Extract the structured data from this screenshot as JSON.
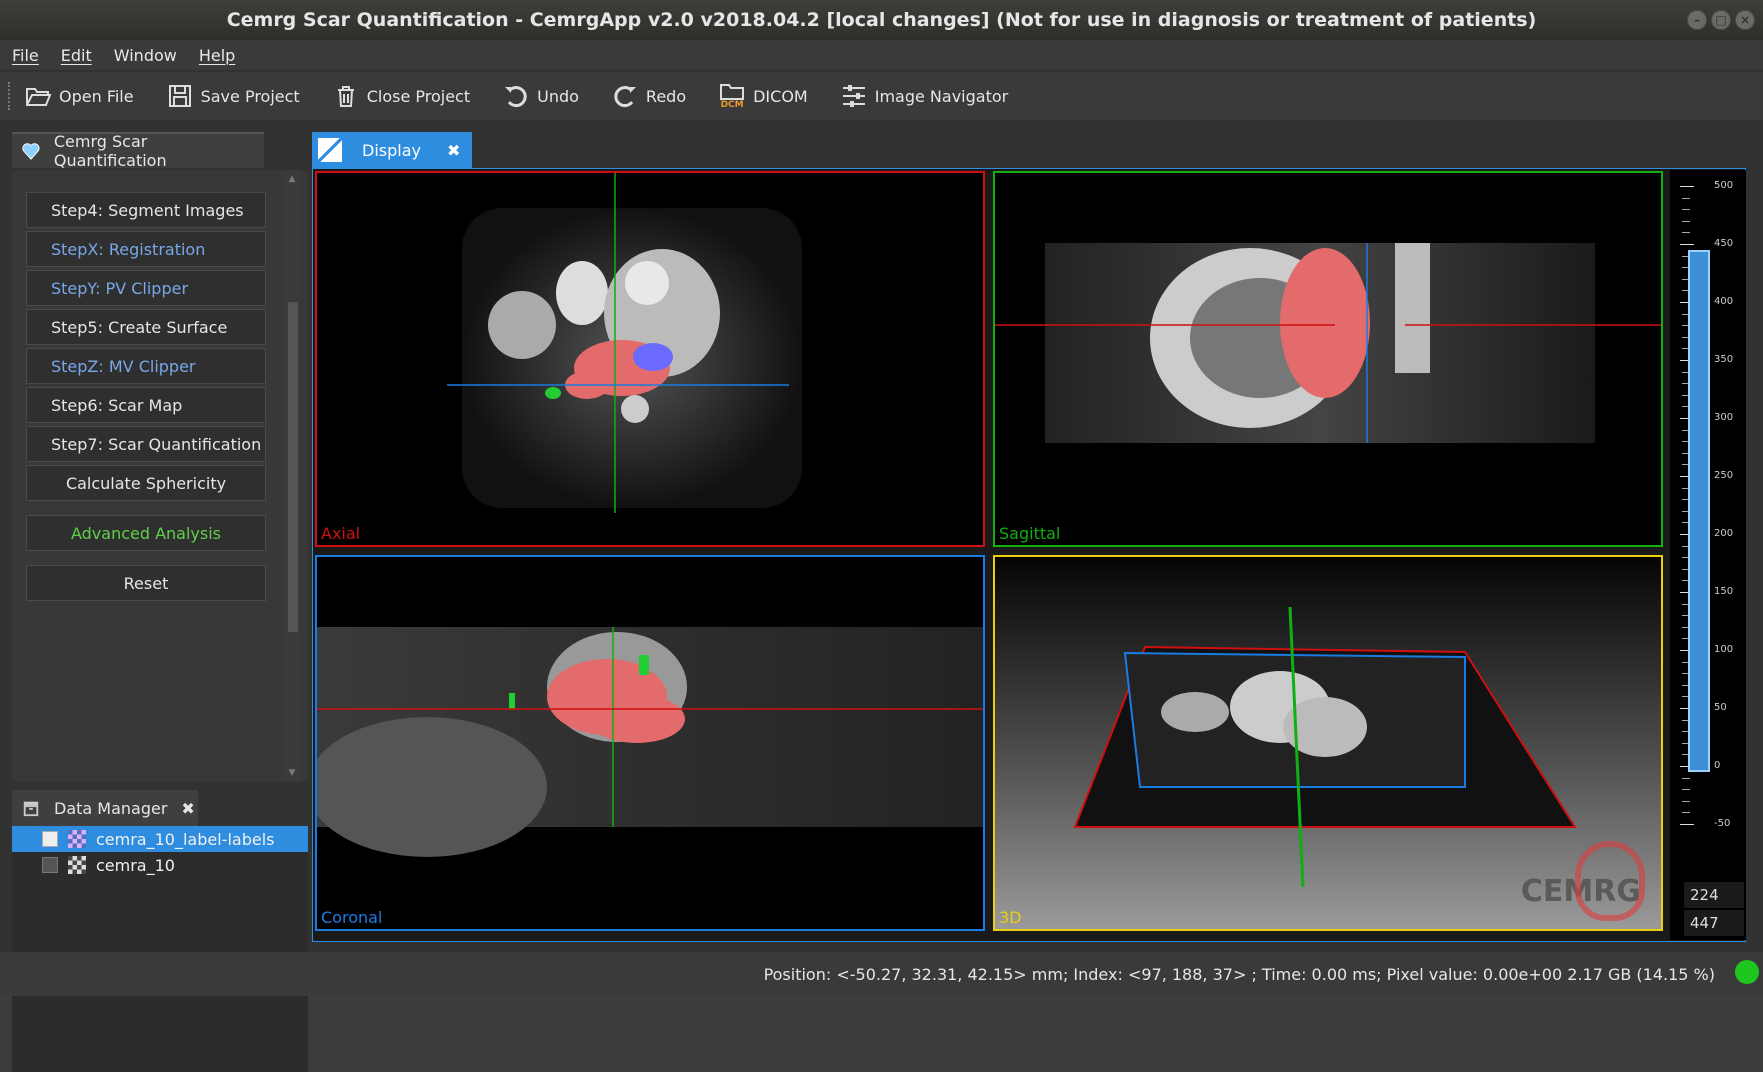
{
  "window": {
    "title": "Cemrg Scar Quantification - CemrgApp v2.0 v2018.04.2 [local changes] (Not for use in diagnosis or treatment of patients)"
  },
  "menu": {
    "file": "File",
    "edit": "Edit",
    "window": "Window",
    "help": "Help"
  },
  "toolbar": {
    "open_file": "Open File",
    "save_project": "Save Project",
    "close_project": "Close Project",
    "undo": "Undo",
    "redo": "Redo",
    "dicom": "DICOM",
    "dicom_icon_text": "DCM",
    "image_navigator": "Image Navigator"
  },
  "plugin": {
    "tab_label": "Cemrg Scar Quantification",
    "steps": [
      {
        "label": "Step4: Segment Images",
        "color": "#e6e6e6"
      },
      {
        "label": "StepX: Registration",
        "color": "#7aa7e8"
      },
      {
        "label": "StepY: PV Clipper",
        "color": "#7aa7e8"
      },
      {
        "label": "Step5: Create Surface",
        "color": "#e6e6e6"
      },
      {
        "label": "StepZ: MV Clipper",
        "color": "#7aa7e8"
      },
      {
        "label": "Step6: Scar Map",
        "color": "#e6e6e6"
      },
      {
        "label": "Step7: Scar Quantification",
        "color": "#e6e6e6"
      },
      {
        "label": "Calculate Sphericity",
        "color": "#e6e6e6"
      },
      {
        "label": "Advanced Analysis",
        "color": "#5fcf4a"
      },
      {
        "label": "Reset",
        "color": "#e6e6e6"
      }
    ]
  },
  "data_manager": {
    "tab_label": "Data Manager",
    "items": [
      {
        "label": "cemra_10_label-labels",
        "selected": true
      },
      {
        "label": "cemra_10",
        "selected": false
      }
    ]
  },
  "display": {
    "tab_label": "Display",
    "views": {
      "axial": "Axial",
      "sagittal": "Sagittal",
      "coronal": "Coronal",
      "threed": "3D"
    },
    "logo_text": "CEMRG"
  },
  "level_window": {
    "ticks": [
      "500",
      "450",
      "400",
      "350",
      "300",
      "250",
      "200",
      "150",
      "100",
      "50",
      "0",
      "-50"
    ],
    "level": "224",
    "window": "447"
  },
  "status": {
    "text": "Position: <-50.27, 32.31, 42.15> mm; Index: <97, 188, 37> ; Time: 0.00 ms; Pixel value: 0.00e+00  2.17 GB (14.15 %)"
  },
  "colors": {
    "accent": "#2f8de0",
    "axial": "#d01010",
    "sagittal": "#10b010",
    "coronal": "#1a7be0",
    "threed": "#e8d010"
  }
}
